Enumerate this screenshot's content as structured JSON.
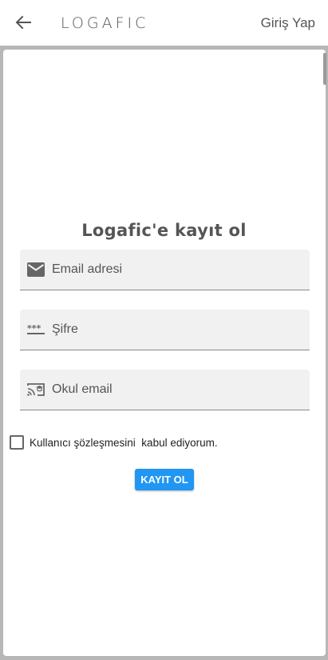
{
  "appbar": {
    "logo": "LOGAFIC",
    "login_label": "Giriş Yap"
  },
  "signup": {
    "title": "Logafic'e kayıt ol",
    "email_placeholder": "Email adresi",
    "password_placeholder": "Şifre",
    "school_email_placeholder": "Okul email",
    "agreement_label": "Kullanıcı şözleşmesini  kabul ediyorum.",
    "submit_label": "KAYIT OL"
  },
  "colors": {
    "accent": "#2196f3",
    "frame": "#b7b7b7",
    "field_bg": "#f1f1f1",
    "text_muted": "#555555"
  },
  "icons": {
    "back": "arrow-left-icon",
    "email": "mail-icon",
    "password": "password-dots-icon",
    "school_email": "school-email-icon"
  }
}
